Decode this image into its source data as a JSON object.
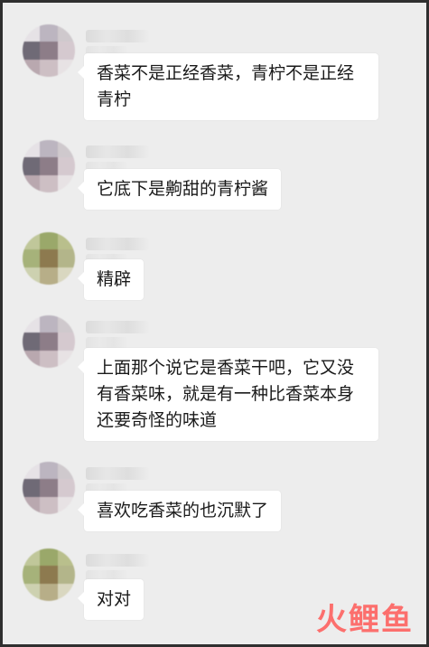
{
  "messages": [
    {
      "text": "香菜不是正经香菜，青柠不是正经青柠",
      "avatar": [
        "#e6e2e6",
        "#bcb5c0",
        "#cfc9cd",
        "#6f6a76",
        "#8d7d88",
        "#d5c9cf",
        "#b9a8af",
        "#cdbfc4",
        "#e7e2e4"
      ]
    },
    {
      "text": "它底下是齁甜的青柠酱",
      "avatar": [
        "#e6e2e6",
        "#bcb5c0",
        "#cfc9cd",
        "#6f6a76",
        "#8d7d88",
        "#d5c9cf",
        "#b9a8af",
        "#cdbfc4",
        "#e7e2e4"
      ]
    },
    {
      "text": "精辟",
      "avatar": [
        "#c0c79a",
        "#9aa86a",
        "#b9bf8c",
        "#a6b27a",
        "#8d7a4f",
        "#b3b58a",
        "#cdd1b0",
        "#b7ae88",
        "#d9d7c0"
      ]
    },
    {
      "text": "上面那个说它是香菜干吧，它又没有香菜味，就是有一种比香菜本身还要奇怪的味道",
      "avatar": [
        "#e6e2e6",
        "#bcb5c0",
        "#cfc9cd",
        "#6f6a76",
        "#8d7d88",
        "#d5c9cf",
        "#b9a8af",
        "#cdbfc4",
        "#e7e2e4"
      ]
    },
    {
      "text": "喜欢吃香菜的也沉默了",
      "avatar": [
        "#e6e2e6",
        "#bcb5c0",
        "#cfc9cd",
        "#6f6a76",
        "#8d7d88",
        "#d5c9cf",
        "#b9a8af",
        "#cdbfc4",
        "#e7e2e4"
      ]
    },
    {
      "text": "对对",
      "avatar": [
        "#c0c79a",
        "#9aa86a",
        "#b9bf8c",
        "#a6b27a",
        "#8d7a4f",
        "#b3b58a",
        "#cdd1b0",
        "#b7ae88",
        "#d9d7c0"
      ]
    }
  ],
  "watermark": "火鲤鱼",
  "colors": {
    "background": "#ededed",
    "bubble": "#ffffff",
    "frame": "#2f2f2f",
    "watermark": "#ff5a57"
  }
}
